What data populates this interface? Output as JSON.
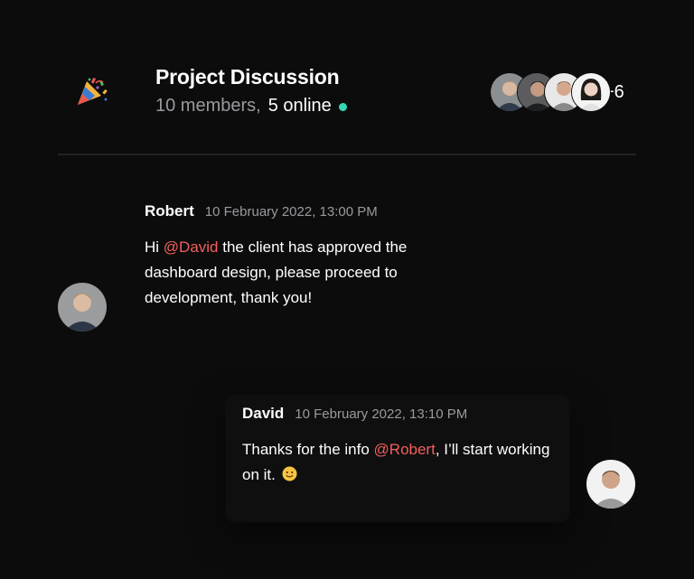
{
  "header": {
    "icon": "party-popper-icon",
    "title": "Project Discussion",
    "members_text": "10 members,",
    "online_text": "5 online",
    "online_color": "#35d7b4",
    "more_members": "+6"
  },
  "messages": [
    {
      "author": "Robert",
      "time": "10 February 2022, 13:00 PM",
      "text_before": "Hi ",
      "mention": "@David",
      "text_after": " the client has approved the dashboard design, please proceed to development, thank you!"
    },
    {
      "author": "David",
      "time": "10 February 2022, 13:10 PM",
      "text_before": "Thanks for the info ",
      "mention": "@Robert",
      "text_after": ", I’ll start working on it.",
      "emoji": "smiling-face-icon"
    }
  ],
  "colors": {
    "background": "#0c0c0d",
    "mention": "#f0605d",
    "muted_text": "#9a9a9e"
  }
}
